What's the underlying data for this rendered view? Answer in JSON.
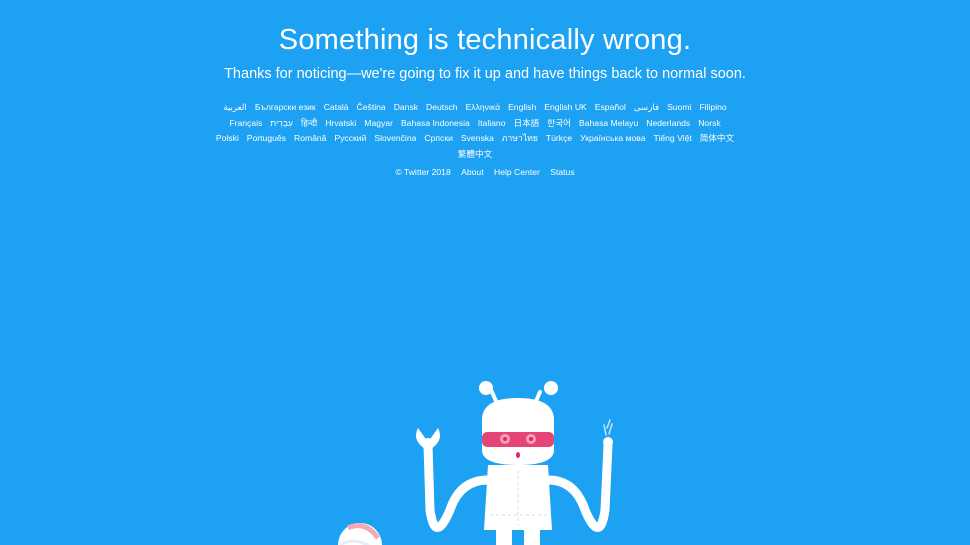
{
  "header": {
    "title": "Something is technically wrong.",
    "subtitle": "Thanks for noticing—we're going to fix it up and have things back to normal soon."
  },
  "languages": [
    "العربية",
    "Български език",
    "Català",
    "Čeština",
    "Dansk",
    "Deutsch",
    "Ελληνικά",
    "English",
    "English UK",
    "Español",
    "فارسی",
    "Suomi",
    "Filipino",
    "Français",
    "עִבְרִית",
    "हिन्दी",
    "Hrvatski",
    "Magyar",
    "Bahasa Indonesia",
    "Italiano",
    "日本語",
    "한국어",
    "Bahasa Melayu",
    "Nederlands",
    "Norsk",
    "Polski",
    "Português",
    "Română",
    "Русский",
    "Slovenčina",
    "Српски",
    "Svenska",
    "ภาษาไทย",
    "Türkçe",
    "Українська мова",
    "Tiếng Việt",
    "简体中文",
    "繁體中文"
  ],
  "footer": {
    "copyright": "© Twitter 2018",
    "about": "About",
    "help_center": "Help Center",
    "status": "Status"
  },
  "colors": {
    "background": "#1da1f2",
    "text": "#ffffff",
    "robot_body": "#ffffff",
    "robot_visor": "#e0245e"
  },
  "illustration": {
    "icon": "broken-robot-icon"
  }
}
